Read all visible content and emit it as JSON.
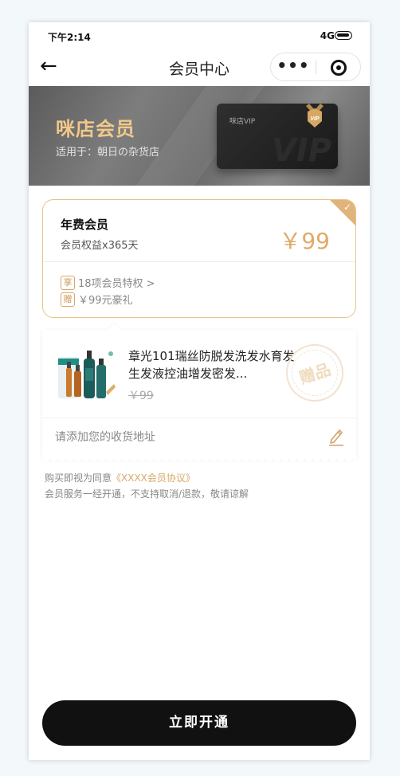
{
  "status_bar": {
    "time": "下午2:14",
    "network": "4G"
  },
  "nav": {
    "back_icon": "←",
    "title": "会员中心",
    "more_icon": "•••"
  },
  "banner": {
    "title": "咪店会员",
    "subtitle": "适用于：朝日の杂货店",
    "card_label": "咪店VIP",
    "card_watermark": "VIP",
    "badge_text": "VIP"
  },
  "membership": {
    "plan_name": "年费会员",
    "plan_desc": "会员权益x365天",
    "price": "￥99",
    "perks": [
      {
        "tag": "享",
        "text": "18项会员特权 >"
      },
      {
        "tag": "赠",
        "text": "￥99元豪礼"
      }
    ]
  },
  "gift": {
    "product_title": "章光101瑞丝防脱发洗发水育发生发液控油增发密发...",
    "original_price": "￥99",
    "stamp_text": "赠品",
    "address_placeholder": "请添加您的收货地址"
  },
  "agreement": {
    "prefix": "购买即视为同意",
    "link_text": "《XXXX会员协议》",
    "notice": "会员服务一经开通，不支持取消/退款，敬请谅解"
  },
  "cta": {
    "label": "立即开通"
  },
  "colors": {
    "gold": "#e0ab66",
    "banner_title": "#f1c98a",
    "button": "#111111"
  }
}
